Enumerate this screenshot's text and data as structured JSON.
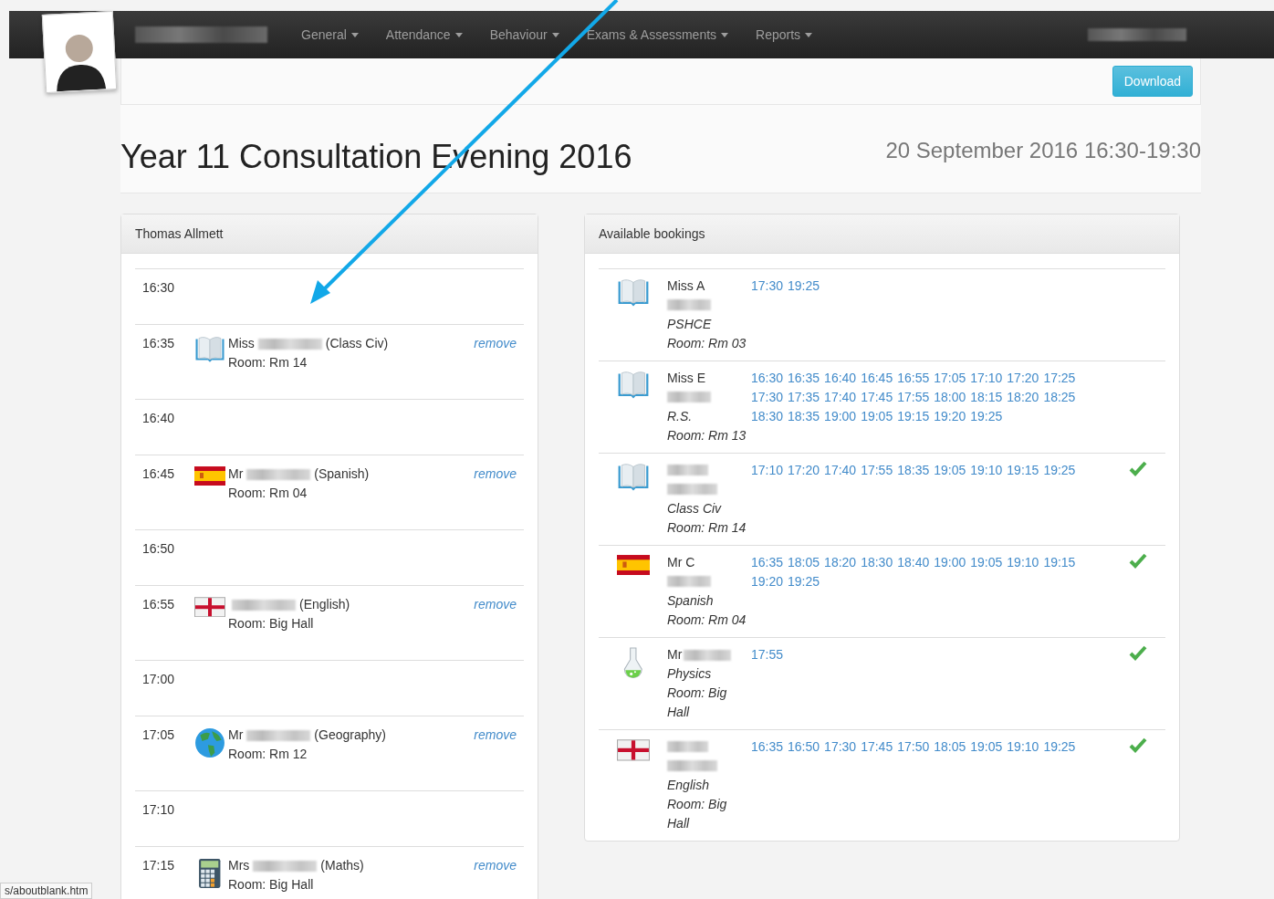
{
  "nav": {
    "items": [
      {
        "label": "General"
      },
      {
        "label": "Attendance"
      },
      {
        "label": "Behaviour"
      },
      {
        "label": "Exams & Assessments"
      },
      {
        "label": "Reports"
      }
    ]
  },
  "toolbar": {
    "button": "Download"
  },
  "heading": {
    "title": "Year 11 Consultation Evening 2016",
    "date": "20 September 2016 16:30-19:30"
  },
  "student_panel": {
    "title": "Thomas Allmett",
    "slots": [
      {
        "time": "16:30"
      },
      {
        "time": "16:35",
        "booking": {
          "icon": {
            "kind": "book"
          },
          "name": "Miss",
          "subject": "(Class Civ)",
          "room": "Room: Rm 14",
          "action": "remove"
        }
      },
      {
        "time": "16:40"
      },
      {
        "time": "16:45",
        "booking": {
          "icon": {
            "kind": "spain"
          },
          "name": "Mr",
          "subject": "(Spanish)",
          "room": "Room: Rm 04",
          "action": "remove"
        }
      },
      {
        "time": "16:50"
      },
      {
        "time": "16:55",
        "booking": {
          "icon": {
            "kind": "england"
          },
          "subject": "(English)",
          "room": "Room: Big Hall",
          "action": "remove"
        }
      },
      {
        "time": "17:00"
      },
      {
        "time": "17:05",
        "booking": {
          "icon": {
            "kind": "globe"
          },
          "name": "Mr",
          "subject": "(Geography)",
          "room": "Room: Rm 12",
          "action": "remove"
        }
      },
      {
        "time": "17:10"
      },
      {
        "time": "17:15",
        "booking": {
          "icon": {
            "kind": "calculator"
          },
          "name": "Mrs",
          "subject": "(Maths)",
          "room": "Room: Big Hall",
          "action": "remove"
        }
      }
    ]
  },
  "bookings_panel": {
    "title": "Available bookings",
    "teachers": [
      {
        "icon": {
          "kind": "book"
        },
        "kind": "stacked",
        "name": "Miss A",
        "subject": "PSHCE",
        "room": "Room: Rm 03",
        "times": [
          "17:30",
          "19:25"
        ],
        "booked": false
      },
      {
        "icon": {
          "kind": "book"
        },
        "kind": "stacked",
        "name": "Miss E",
        "subject": "R.S.",
        "room": "Room: Rm 13",
        "times": [
          "16:30",
          "16:35",
          "16:40",
          "16:45",
          "16:55",
          "17:05",
          "17:10",
          "17:20",
          "17:25",
          "17:30",
          "17:35",
          "17:40",
          "17:45",
          "17:55",
          "18:00",
          "18:15",
          "18:20",
          "18:25",
          "18:30",
          "18:35",
          "19:00",
          "19:05",
          "19:15",
          "19:20",
          "19:25"
        ],
        "booked": false
      },
      {
        "icon": {
          "kind": "book"
        },
        "kind": "hidden",
        "subject": "Class Civ",
        "room": "Room: Rm 14",
        "times": [
          "17:10",
          "17:20",
          "17:40",
          "17:55",
          "18:35",
          "19:05",
          "19:10",
          "19:15",
          "19:25"
        ],
        "booked": true
      },
      {
        "icon": {
          "kind": "spain"
        },
        "kind": "stacked",
        "name": "Mr C",
        "subject": "Spanish",
        "room": "Room: Rm 04",
        "times": [
          "16:35",
          "18:05",
          "18:20",
          "18:30",
          "18:40",
          "19:00",
          "19:05",
          "19:10",
          "19:15",
          "19:20",
          "19:25"
        ],
        "booked": true
      },
      {
        "icon": {
          "kind": "flask"
        },
        "kind": "inline",
        "name": "Mr",
        "subject": "Physics",
        "room": "Room: Big Hall",
        "times": [
          "17:55"
        ],
        "booked": true
      },
      {
        "icon": {
          "kind": "england"
        },
        "kind": "hidden",
        "subject": "English",
        "room": "Room: Big Hall",
        "times": [
          "16:35",
          "16:50",
          "17:30",
          "17:45",
          "17:50",
          "18:05",
          "19:05",
          "19:10",
          "19:25"
        ],
        "booked": true
      }
    ]
  },
  "status_bar": {
    "url": "s/aboutblank.htm"
  }
}
